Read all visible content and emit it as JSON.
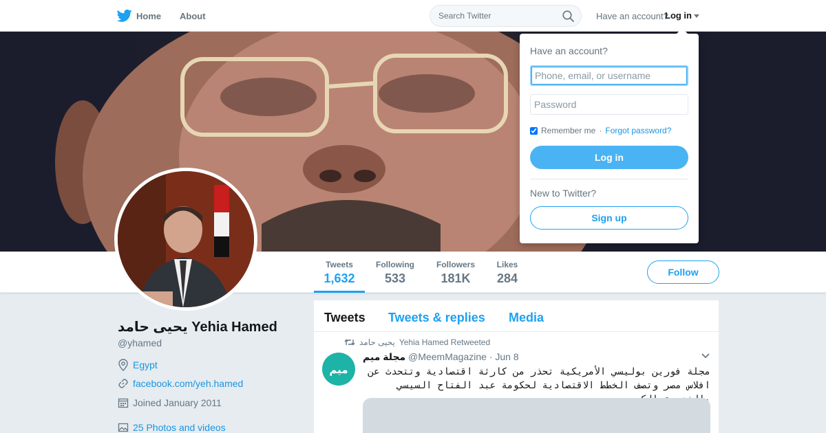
{
  "nav": {
    "home_label": "Home",
    "about_label": "About",
    "search_placeholder": "Search Twitter",
    "have_account": "Have an account?",
    "login_label": "Log in"
  },
  "profile": {
    "display_name": "يحيى حامد Yehia Hamed",
    "handle": "@yhamed",
    "location": "Egypt",
    "website": "facebook.com/yeh.hamed",
    "joined": "Joined January 2011",
    "photos": "25 Photos and videos"
  },
  "stats": [
    {
      "label": "Tweets",
      "value": "1,632",
      "active": true
    },
    {
      "label": "Following",
      "value": "533",
      "active": false
    },
    {
      "label": "Followers",
      "value": "181K",
      "active": false
    },
    {
      "label": "Likes",
      "value": "284",
      "active": false
    }
  ],
  "follow_label": "Follow",
  "timeline": {
    "tabs": [
      {
        "label": "Tweets",
        "active": true
      },
      {
        "label": "Tweets & replies",
        "active": false
      },
      {
        "label": "Media",
        "active": false
      }
    ],
    "tweet": {
      "retweet_by": "يحيى حامد",
      "retweet_suffix": "Yehia Hamed Retweeted",
      "author_name": "مجلة ميم",
      "author_handle": "@MeemMagazine",
      "date": "· Jun 8",
      "avatar_text": "ميم",
      "text": "مجلة فورين بوليسي الأمريكية تحذر من كارثة اقتصادية وتتحدث عن افلاس مصر وتصف الخطط الاقتصادية لحكومة عبد الفتاح السيسي بالخديعة الكبرى"
    }
  },
  "login_dropdown": {
    "title": "Have an account?",
    "username_placeholder": "Phone, email, or username",
    "password_placeholder": "Password",
    "remember_label": "Remember me",
    "separator": "·",
    "forgot_label": "Forgot password?",
    "login_button": "Log in",
    "new_label": "New to Twitter?",
    "signup_button": "Sign up"
  },
  "colors": {
    "accent": "#1da1f2",
    "login_button": "#4ab3f4",
    "page_background": "#e6ecf0"
  }
}
